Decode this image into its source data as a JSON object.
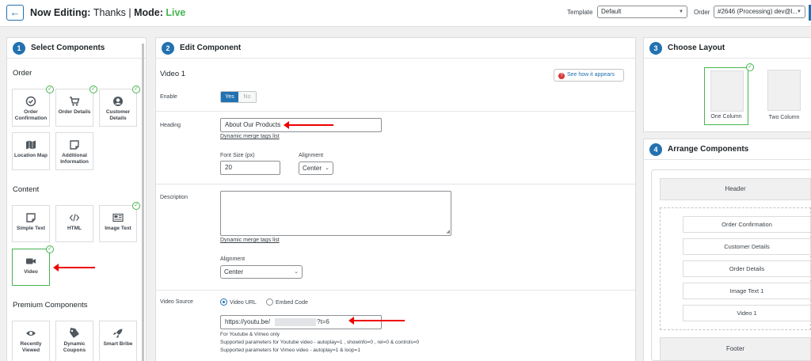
{
  "header": {
    "prefix": "Now Editing:",
    "name": "Thanks",
    "separator": "|",
    "mode_label": "Mode:",
    "mode_value": "Live",
    "template_label": "Template",
    "template_value": "Default",
    "order_label": "Order",
    "order_value": "#2646 (Processing) dev@l..."
  },
  "select_components": {
    "step": "1",
    "title": "Select Components",
    "order_section": "Order",
    "order_items": [
      {
        "label": "Order Confirmation",
        "icon": "check-circle-icon",
        "selected": true
      },
      {
        "label": "Order Details",
        "icon": "cart-icon",
        "selected": true
      },
      {
        "label": "Customer Details",
        "icon": "user-icon",
        "selected": true
      },
      {
        "label": "Location Map",
        "icon": "map-icon",
        "selected": false
      },
      {
        "label": "Additional Information",
        "icon": "note-icon",
        "selected": false
      }
    ],
    "content_section": "Content",
    "content_items": [
      {
        "label": "Simple Text",
        "icon": "note-icon",
        "selected": false
      },
      {
        "label": "HTML",
        "icon": "code-icon",
        "selected": false
      },
      {
        "label": "Image Text",
        "icon": "image-text-icon",
        "selected": true
      },
      {
        "label": "Video",
        "icon": "video-icon",
        "selected": true
      }
    ],
    "premium_section": "Premium Components",
    "premium_items": [
      {
        "label": "Recently Viewed",
        "icon": "eye-icon"
      },
      {
        "label": "Dynamic Coupons",
        "icon": "tag-icon"
      },
      {
        "label": "Smart Bribe",
        "icon": "rocket-icon"
      }
    ]
  },
  "edit_component": {
    "step": "2",
    "title": "Edit Component",
    "component_name": "Video 1",
    "help_button": "See how it appears",
    "enable_label": "Enable",
    "enable_yes": "Yes",
    "enable_no": "No",
    "heading_label": "Heading",
    "heading_value": "About Our Products",
    "merge_tags_link": "Dynamic merge tags list",
    "font_size_label": "Font Size (px)",
    "font_size_value": "20",
    "alignment_label": "Alignment",
    "alignment_value": "Center",
    "description_label": "Description",
    "description_value": "",
    "desc_alignment_label": "Alignment",
    "desc_alignment_value": "Center",
    "video_source_label": "Video Source",
    "source_video_url": "Video URL",
    "source_embed_code": "Embed Code",
    "url_prefix": "https://youtu.be/",
    "url_suffix": "?t=6",
    "note_1": "For Youtube & Vimeo only",
    "note_2": "Supported parameters for Youtube video - autoplay=1 , showinfo=0 , rel=0 & controls=0",
    "note_3": "Supported parameters for Vimeo video - autoplay=1 & loop=1"
  },
  "choose_layout": {
    "step": "3",
    "title": "Choose Layout",
    "options": [
      {
        "label": "One Column",
        "selected": true
      },
      {
        "label": "Two Column",
        "selected": false
      }
    ]
  },
  "arrange_components": {
    "step": "4",
    "title": "Arrange Components",
    "header": "Header",
    "items": [
      "Order Confirmation",
      "Customer Details",
      "Order Details",
      "Image Text 1",
      "Video 1"
    ],
    "footer": "Footer"
  },
  "colors": {
    "accent": "#2271b1",
    "live": "#46b450",
    "selected_border": "#46b450",
    "annotation_arrow": "#ee0000"
  }
}
